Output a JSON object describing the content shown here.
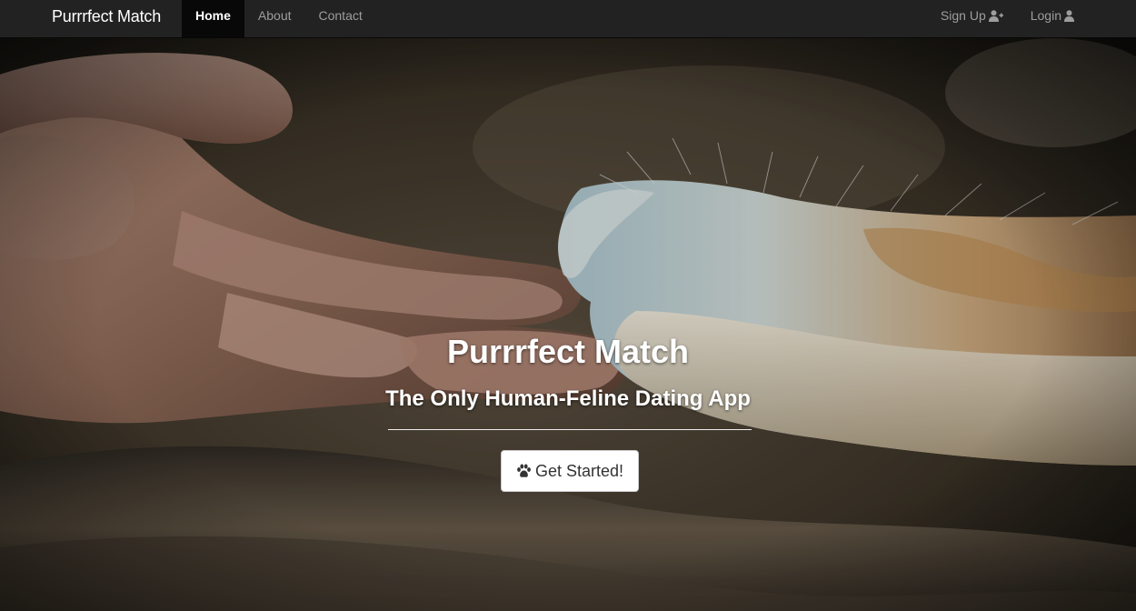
{
  "navbar": {
    "brand": "Purrrfect Match",
    "links": [
      {
        "label": "Home",
        "active": true
      },
      {
        "label": "About",
        "active": false
      },
      {
        "label": "Contact",
        "active": false
      }
    ],
    "right_links": [
      {
        "label": "Sign Up",
        "icon": "user-plus-icon"
      },
      {
        "label": "Login",
        "icon": "user-icon"
      }
    ]
  },
  "hero": {
    "title": "Purrrfect Match",
    "subtitle": "The Only Human-Feline Dating App",
    "cta_label": "Get Started!",
    "cta_icon": "paw-icon",
    "background": "human-hand-touching-cat-paw-photo"
  },
  "colors": {
    "navbar_bg": "#222222",
    "nav_active_bg": "#080808",
    "nav_link": "#9d9d9d",
    "text_white": "#ffffff"
  }
}
